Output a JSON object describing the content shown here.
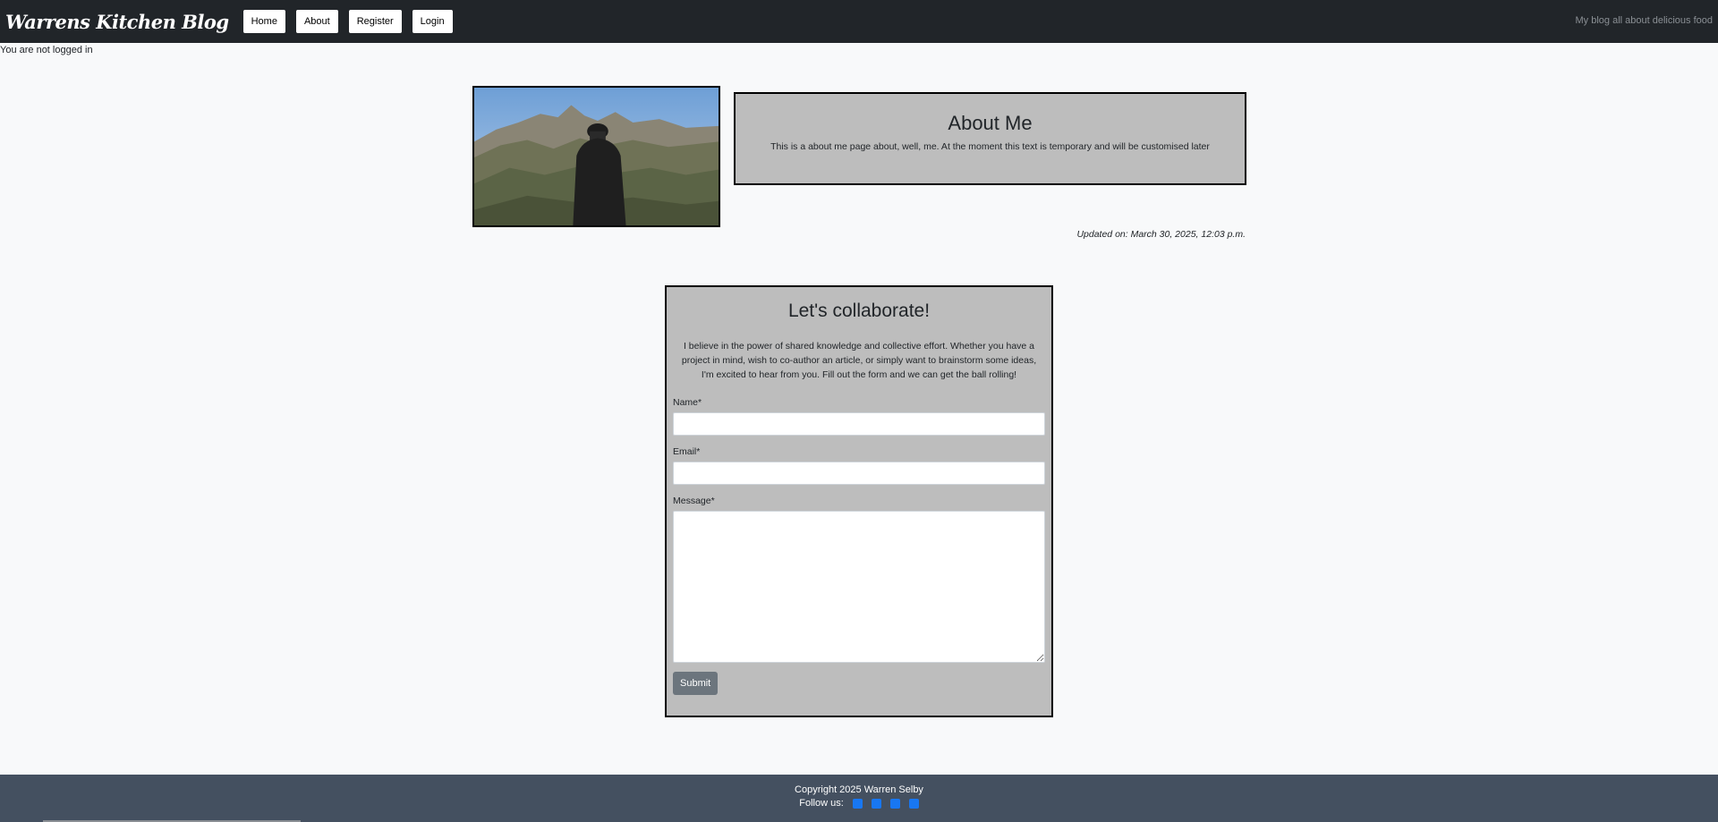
{
  "navbar": {
    "brand": "Warrens Kitchen Blog",
    "links": [
      "Home",
      "About",
      "Register",
      "Login"
    ],
    "tagline": "My blog all about delicious food"
  },
  "login_status": "You are not logged in",
  "about": {
    "title": "About Me",
    "text": "This is a about me page about, well, me. At the moment this text is temporary and will be customised later",
    "updated": "Updated on: March 30, 2025, 12:03 p.m."
  },
  "collab": {
    "title": "Let's collaborate!",
    "intro": "I believe in the power of shared knowledge and collective effort. Whether you have a project in mind, wish to co-author an article, or simply want to brainstorm some ideas, I'm excited to hear from you. Fill out the form and we can get the ball rolling!",
    "name_label": "Name*",
    "name_value": "",
    "email_label": "Email*",
    "email_value": "",
    "message_label": "Message*",
    "message_value": "",
    "submit_label": "Submit"
  },
  "footer": {
    "copyright": "Copyright 2025 Warren Selby",
    "follow_label": "Follow us:",
    "social_icons": [
      "facebook-icon",
      "twitter-icon",
      "instagram-icon",
      "youtube-icon"
    ]
  },
  "colors": {
    "navbar_bg": "#212529",
    "card_bg": "#bdbdbd",
    "footer_bg": "#445060",
    "social_blue": "#1877f2",
    "submit_bg": "#6c757d"
  }
}
